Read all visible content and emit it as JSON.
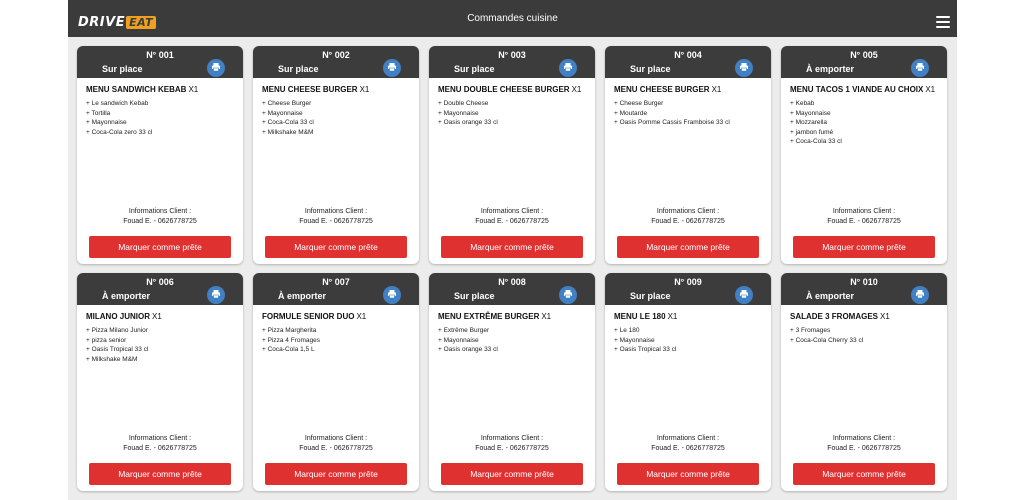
{
  "header": {
    "logo_text": "DRIVE",
    "logo_accent": "EAT",
    "title": "Commandes cuisine",
    "menu_icon": "hamburger-icon"
  },
  "colors": {
    "topbar": "#3b3b3b",
    "card_header": "#3c3c3c",
    "print_button": "#3f81c2",
    "ready_button": "#e03131",
    "background": "#ececec"
  },
  "orders": [
    {
      "number": "N° 001",
      "mode": "Sur place",
      "title": "MENU SANDWICH KEBAB",
      "qty": "X1",
      "items": [
        "+ Le sandwich Kebab",
        "+ Tortilla",
        "+ Mayonnaise",
        "+ Coca-Cola zero 33 cl"
      ],
      "client_label": "Informations Client :",
      "client_value": "Fouad E. - 0626778725",
      "button": "Marquer comme prête"
    },
    {
      "number": "N° 002",
      "mode": "Sur place",
      "title": "MENU CHEESE BURGER",
      "qty": "X1",
      "items": [
        "+ Cheese Burger",
        "+ Mayonnaise",
        "+ Coca-Cola 33 cl",
        "+ Milkshake M&M"
      ],
      "client_label": "Informations Client :",
      "client_value": "Fouad E. - 0626778725",
      "button": "Marquer comme prête"
    },
    {
      "number": "N° 003",
      "mode": "Sur place",
      "title": "MENU DOUBLE CHEESE BURGER",
      "qty": "X1",
      "items": [
        "+ Double Cheese",
        "+ Mayonnaise",
        "+ Oasis orange 33 cl"
      ],
      "client_label": "Informations Client :",
      "client_value": "Fouad E. - 0626778725",
      "button": "Marquer comme prête"
    },
    {
      "number": "N° 004",
      "mode": "Sur place",
      "title": "MENU CHEESE BURGER",
      "qty": "X1",
      "items": [
        "+ Cheese Burger",
        "+ Moutarde",
        "+ Oasis Pomme Cassis Framboise 33 cl"
      ],
      "client_label": "Informations Client :",
      "client_value": "Fouad E. - 0626778725",
      "button": "Marquer comme prête"
    },
    {
      "number": "N° 005",
      "mode": "À emporter",
      "title": "MENU TACOS 1 VIANDE AU CHOIX",
      "qty": "X1",
      "items": [
        "+ Kebab",
        "+ Mayonnaise",
        "+ Mozzarella",
        "+ jambon fumé",
        "+ Coca-Cola 33 cl"
      ],
      "client_label": "Informations Client :",
      "client_value": "Fouad E. - 0626778725",
      "button": "Marquer comme prête"
    },
    {
      "number": "N° 006",
      "mode": "À emporter",
      "title": "MILANO JUNIOR",
      "qty": "X1",
      "items": [
        "+ Pizza Milano Junior",
        "+ pizza senior",
        "+ Oasis Tropical 33 cl",
        "+ Milkshake M&M"
      ],
      "client_label": "Informations Client :",
      "client_value": "Fouad E. - 0626778725",
      "button": "Marquer comme prête"
    },
    {
      "number": "N° 007",
      "mode": "À emporter",
      "title": "FORMULE SENIOR DUO",
      "qty": "X1",
      "items": [
        "+ Pizza Margherita",
        "+ Pizza 4 Fromages",
        "+ Coca-Cola 1,5 L"
      ],
      "client_label": "Informations Client :",
      "client_value": "Fouad E. - 0626778725",
      "button": "Marquer comme prête"
    },
    {
      "number": "N° 008",
      "mode": "Sur place",
      "title": "MENU EXTRÊME BURGER",
      "qty": "X1",
      "items": [
        "+ Extrême Burger",
        "+ Mayonnaise",
        "+ Oasis orange 33 cl"
      ],
      "client_label": "Informations Client :",
      "client_value": "Fouad E. - 0626778725",
      "button": "Marquer comme prête"
    },
    {
      "number": "N° 009",
      "mode": "Sur place",
      "title": "MENU LE 180",
      "qty": "X1",
      "items": [
        "+ Le 180",
        "+ Mayonnaise",
        "+ Oasis Tropical 33 cl"
      ],
      "client_label": "Informations Client :",
      "client_value": "Fouad E. - 0626778725",
      "button": "Marquer comme prête"
    },
    {
      "number": "N° 010",
      "mode": "À emporter",
      "title": "SALADE 3 FROMAGES",
      "qty": "X1",
      "items": [
        "+ 3 Fromages",
        "+ Coca-Cola Cherry 33 cl"
      ],
      "client_label": "Informations Client :",
      "client_value": "Fouad E. - 0626778725",
      "button": "Marquer comme prête"
    }
  ]
}
